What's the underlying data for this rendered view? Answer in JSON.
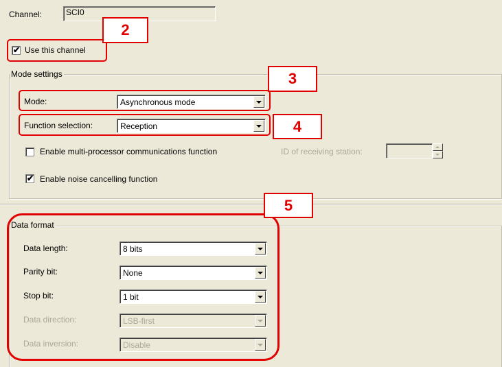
{
  "channel": {
    "label": "Channel:",
    "value": "SCI0"
  },
  "use_channel": {
    "label": "Use this channel",
    "checked": true
  },
  "mode_settings": {
    "title": "Mode settings",
    "mode": {
      "label": "Mode:",
      "value": "Asynchronous mode"
    },
    "function_selection": {
      "label": "Function selection:",
      "value": "Reception"
    },
    "multiprocessor": {
      "label": "Enable multi-processor communications function",
      "checked": false
    },
    "receiving_station": {
      "label": "ID of receiving station:",
      "value": ""
    },
    "noise_cancel": {
      "label": "Enable noise cancelling function",
      "checked": true
    }
  },
  "data_format": {
    "title": "Data format",
    "data_length": {
      "label": "Data length:",
      "value": "8 bits"
    },
    "parity_bit": {
      "label": "Parity bit:",
      "value": "None"
    },
    "stop_bit": {
      "label": "Stop bit:",
      "value": "1 bit"
    },
    "data_direction": {
      "label": "Data direction:",
      "value": "LSB-first",
      "enabled": false
    },
    "data_inversion": {
      "label": "Data inversion:",
      "value": "Disable",
      "enabled": false
    }
  },
  "annotations": {
    "n2": "2",
    "n3": "3",
    "n4": "4",
    "n5": "5",
    "color": "#e00000"
  },
  "icons": {
    "check": "✔",
    "dropdown": "chevron-down-icon"
  }
}
